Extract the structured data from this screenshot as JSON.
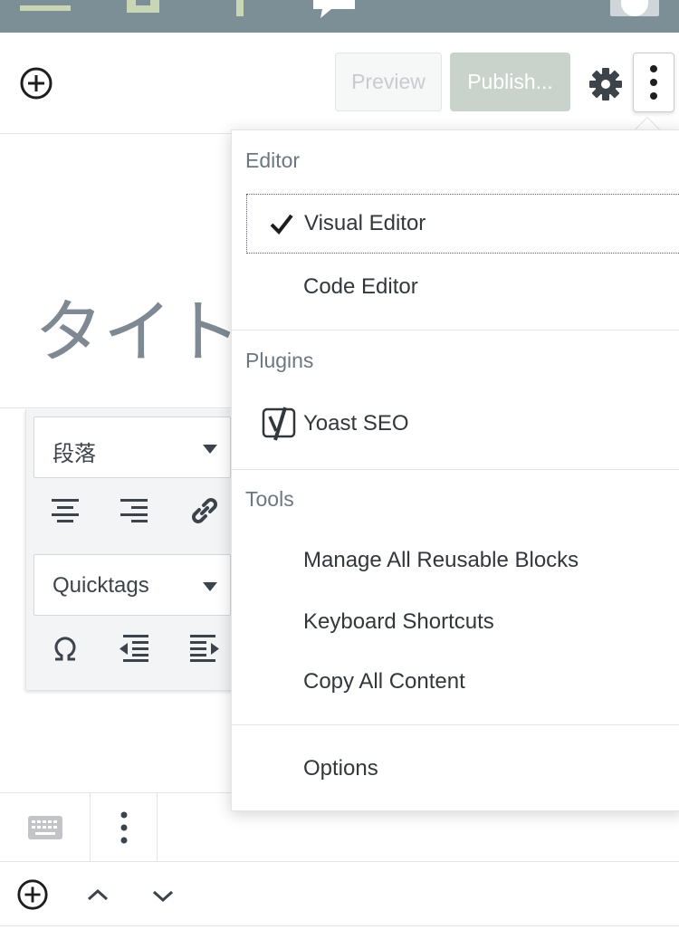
{
  "header": {
    "preview_label": "Preview",
    "publish_label": "Publish...",
    "add_block_icon": "plus-circle-icon",
    "settings_icon": "gear-icon",
    "more_icon": "vertical-ellipsis-icon"
  },
  "title": {
    "text": "タイト"
  },
  "block_toolbar": {
    "format_select": "段落",
    "quicktags_select": "Quicktags"
  },
  "menu": {
    "editor": {
      "label": "Editor",
      "items": [
        {
          "label": "Visual Editor",
          "selected": true
        },
        {
          "label": "Code Editor"
        }
      ]
    },
    "plugins": {
      "label": "Plugins",
      "items": [
        {
          "label": "Yoast SEO",
          "icon": "yoast-icon"
        }
      ]
    },
    "tools": {
      "label": "Tools",
      "items": [
        {
          "label": "Manage All Reusable Blocks"
        },
        {
          "label": "Keyboard Shortcuts"
        },
        {
          "label": "Copy All Content"
        }
      ]
    },
    "options": {
      "label": "Options"
    }
  },
  "colors": {
    "admin_bar": "#7c8f96",
    "publish_disabled": "#c9d3cc",
    "text_muted": "#6c7781"
  }
}
